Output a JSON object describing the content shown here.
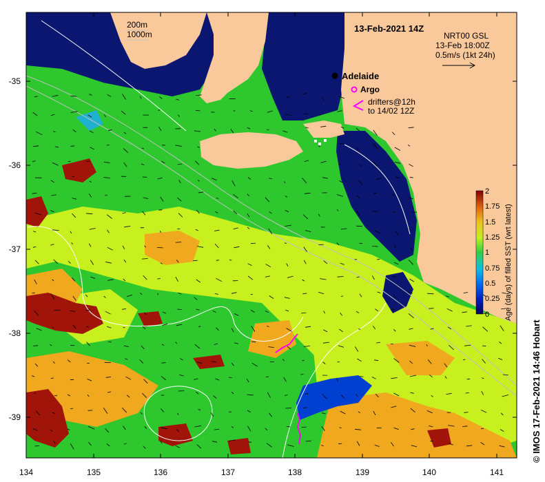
{
  "map": {
    "date_title": "13-Feb-2021 14Z",
    "city_label": "Adelaide",
    "bathymetry": {
      "line1": "200m",
      "line2": "1000m"
    },
    "currents": {
      "line1": "NRT00 GSL",
      "line2": "13-Feb 18:00Z",
      "line3": "0.5m/s (1kt 24h)"
    },
    "argo_label": "Argo",
    "drifters": {
      "line1": "drifters@12h",
      "line2": "to 14/02 12Z"
    },
    "credit": "© IMOS 17-Feb-2021 14:46 Hobart",
    "x_ticks": [
      "134",
      "135",
      "136",
      "137",
      "138",
      "139",
      "140",
      "141"
    ],
    "y_ticks": [
      "-35",
      "-36",
      "-37",
      "-38",
      "-39"
    ],
    "colorbar": {
      "label": "Age (days) of filled SST (wrt latest)",
      "min": 0,
      "max": 2,
      "ticks": [
        "2",
        "1.75",
        "1.5",
        "1.25",
        "1",
        "0.75",
        "0.5",
        "0.25",
        "0"
      ]
    },
    "colors": {
      "land": "#f9c89b",
      "deep_blue": "#0a1670",
      "green": "#2ec82e",
      "yellow_green": "#c8f01e",
      "orange": "#f0a81e",
      "dark_red": "#a0140a",
      "argo": "#ff00ff"
    }
  }
}
